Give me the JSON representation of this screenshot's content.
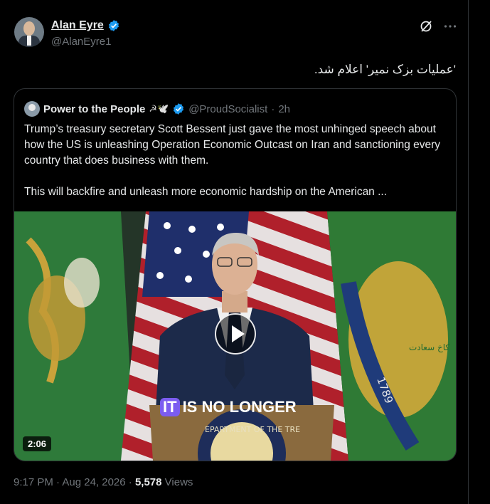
{
  "author": {
    "display_name": "Alan Eyre",
    "handle": "@AlanEyre1"
  },
  "tweet": {
    "text": "'عملیات بزک نمیر' اعلام شد.",
    "timestamp": "9:17 PM · Aug 24, 2026 · ",
    "views_count": "5,578",
    "views_label": " Views"
  },
  "quote": {
    "display_name": "Power to the People",
    "emojis": "☭🕊️",
    "handle": "@ProudSocialist",
    "separator": "·",
    "time": "2h",
    "text_p1": "Trump’s treasury secretary Scott Bessent just gave the most unhinged speech about how the US is unleashing Operation Economic Outcast on Iran and sanctioning every country that does business with them.",
    "text_p2": "This will backfire and unleash more economic hardship on the American ..."
  },
  "video": {
    "duration": "2:06",
    "caption_highlight": "IT",
    "caption_rest": "IS NO LONGER",
    "seal_text": "EPARTMENT OF THE TRE",
    "flag_text": "کاخ سعادت",
    "flag_year": "1789"
  },
  "colors": {
    "verified": "#1d9bf0",
    "background": "#000000",
    "muted": "#71767b",
    "border": "#2f3336"
  },
  "icons": {
    "verified": "verified-badge-icon",
    "grok": "grok-icon",
    "more": "more-icon",
    "play": "play-icon"
  }
}
